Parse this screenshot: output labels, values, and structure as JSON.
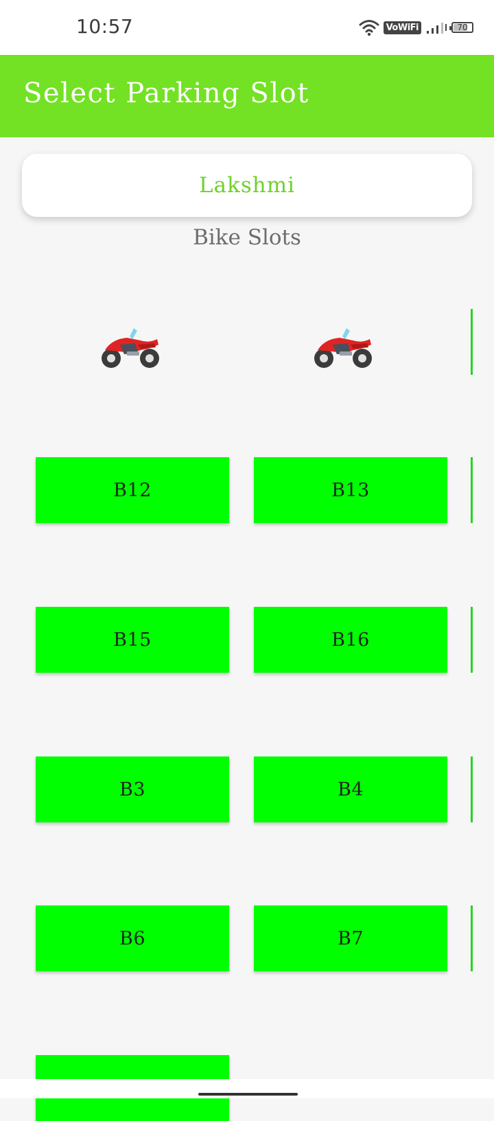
{
  "status_bar": {
    "time": "10:57",
    "vowifi": "VoWiFi",
    "battery": "70"
  },
  "app_bar": {
    "title": "Select Parking Slot"
  },
  "location": {
    "name": "Lakshmi"
  },
  "section": {
    "title": "Bike Slots"
  },
  "occupied_icon": "motorcycle-icon",
  "slots": {
    "r1c1": "",
    "r1c2": "",
    "r2c1": "B12",
    "r2c2": "B13",
    "r3c1": "B15",
    "r3c2": "B16",
    "r4c1": "B3",
    "r4c2": "B4",
    "r5c1": "B6",
    "r5c2": "B7"
  },
  "colors": {
    "app_bar": "#73e124",
    "available_slot": "#00ff00",
    "location_text": "#6fd12a",
    "background": "#f6f6f6"
  }
}
